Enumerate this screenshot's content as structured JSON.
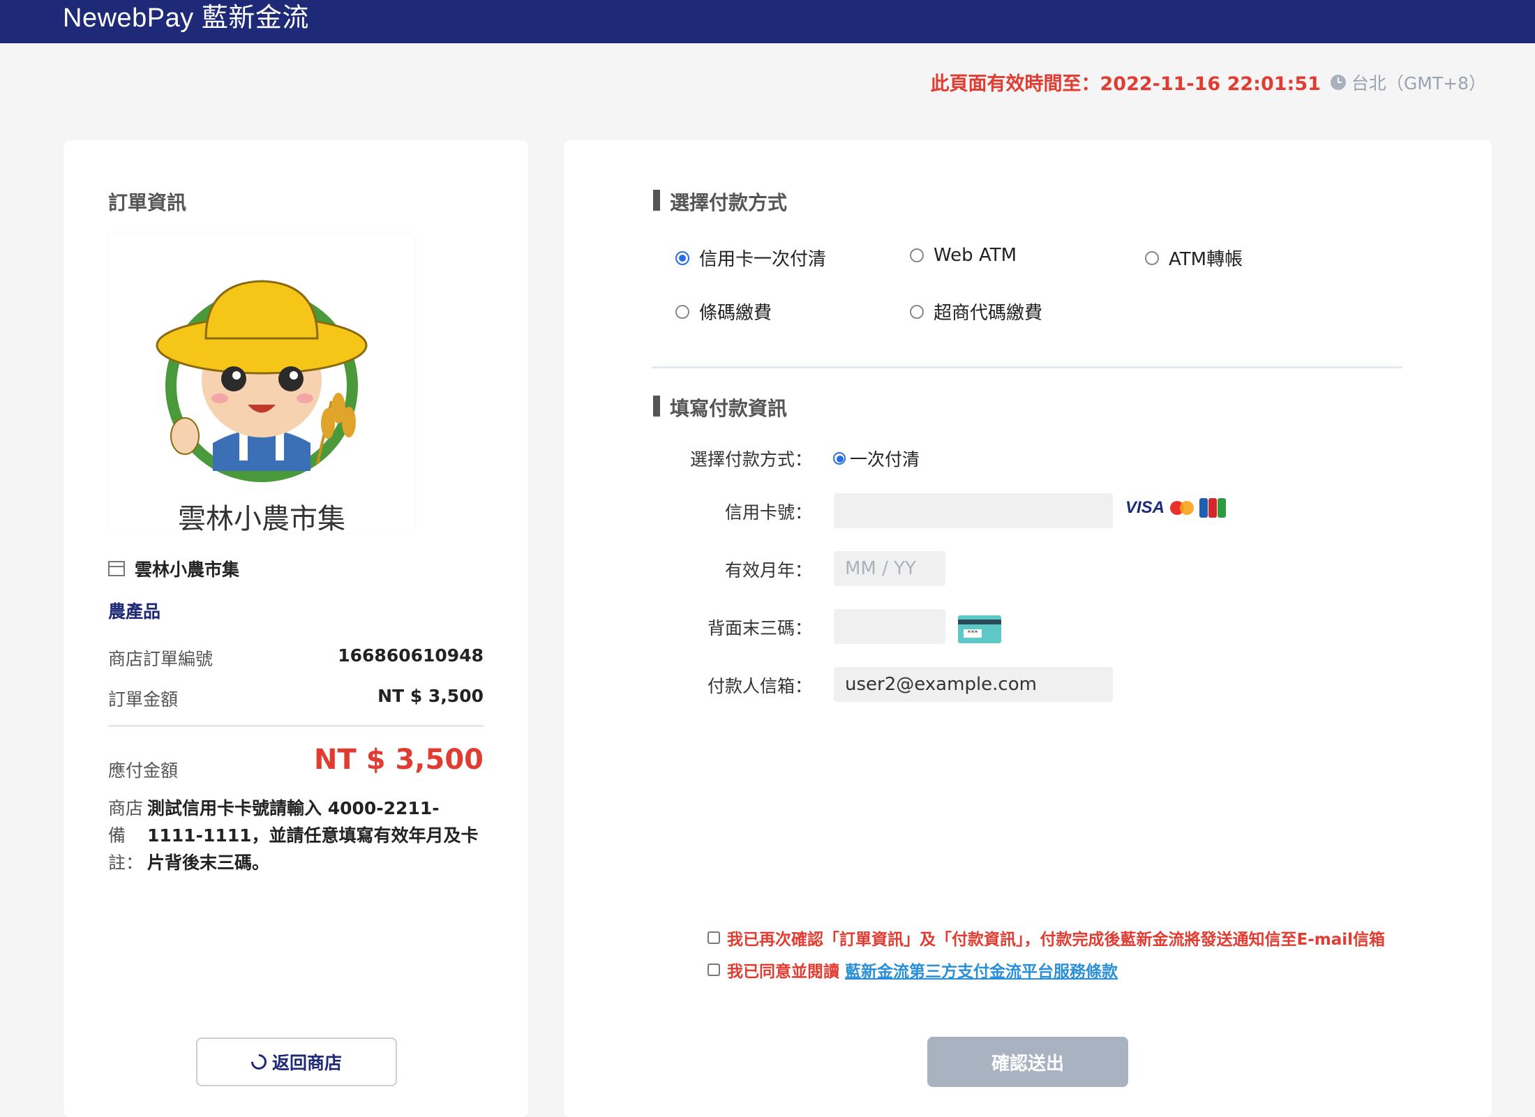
{
  "header": {
    "brand": "NewebPay 藍新金流"
  },
  "expiry": {
    "label": "此頁面有效時間至：2022-11-16 22:01:51",
    "timezone": "台北（GMT+8）",
    "clock_icon": "clock-icon"
  },
  "order": {
    "section_title": "訂單資訊",
    "logo_caption": "雲林小農市集",
    "store_name": "雲林小農市集",
    "store_icon": "store-icon",
    "category": "農產品",
    "order_no_label": "商店訂單編號",
    "order_no": "166860610948",
    "amount_label": "訂單金額",
    "amount": "NT $ 3,500",
    "payable_label": "應付金額",
    "payable": "NT $ 3,500",
    "note_label": "商店備註：",
    "note": "測試信用卡卡號請輸入 4000-2211-1111-1111，並請任意填寫有效年月及卡片背後末三碼。",
    "back_button": "返回商店"
  },
  "payment_methods": {
    "title": "選擇付款方式",
    "options": [
      {
        "label": "信用卡一次付清",
        "selected": true
      },
      {
        "label": "Web ATM",
        "selected": false
      },
      {
        "label": "ATM轉帳",
        "selected": false
      },
      {
        "label": "條碼繳費",
        "selected": false
      },
      {
        "label": "超商代碼繳費",
        "selected": false
      }
    ]
  },
  "payment_form": {
    "title": "填寫付款資訊",
    "method_label": "選擇付款方式：",
    "method_option": "一次付清",
    "card_no_label": "信用卡號：",
    "card_no_value": "",
    "expiry_label": "有效月年：",
    "expiry_placeholder": "MM  /  YY",
    "cvv_label": "背面末三碼：",
    "cvv_value": "",
    "email_label": "付款人信箱：",
    "email_value": "user2@example.com",
    "card_brands": [
      "VISA",
      "MasterCard",
      "JCB"
    ]
  },
  "agreements": {
    "confirm_text": "我已再次確認「訂單資訊」及「付款資訊」，付款完成後藍新金流將發送通知信至E-mail信箱",
    "agree_text": "我已同意並閱讀",
    "terms_link": "藍新金流第三方支付金流平台服務條款"
  },
  "submit_button": "確認送出",
  "colors": {
    "navy": "#1e2a78",
    "alert_red": "#e03c31",
    "link_blue": "#2a8fd9",
    "radio_blue": "#2a6fe0",
    "disabled_button": "#a9b2c0"
  }
}
